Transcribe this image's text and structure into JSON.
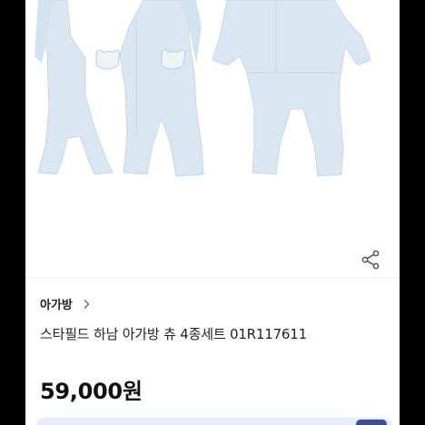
{
  "product": {
    "seller_name": "아가방",
    "title": "스타필드 하남 아가방 츄 4종세트 01R117611",
    "price": "59,000원"
  },
  "icons": {
    "share": "share-icon",
    "chevron": "chevron-right-icon"
  },
  "colors": {
    "garment": "#d9e6f0",
    "garment_shadow": "#c4d4e2",
    "accent_bar": "#e6ecf9",
    "badge": "#3b4d9c"
  }
}
